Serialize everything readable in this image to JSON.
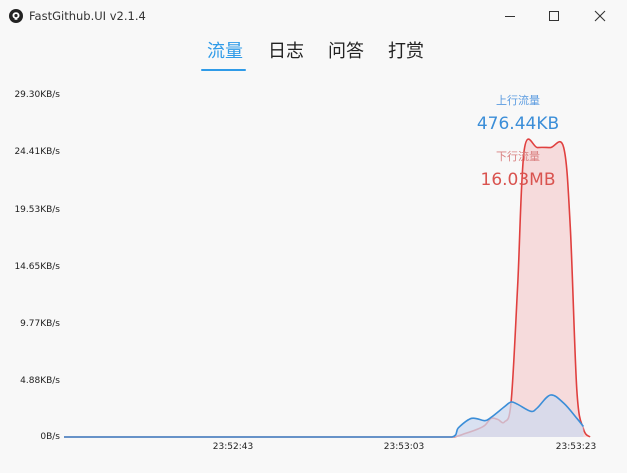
{
  "window": {
    "title": "FastGithub.UI v2.1.4"
  },
  "tabs": [
    {
      "label": "流量",
      "active": true
    },
    {
      "label": "日志",
      "active": false
    },
    {
      "label": "问答",
      "active": false
    },
    {
      "label": "打赏",
      "active": false
    }
  ],
  "icons": {
    "app": "github-icon",
    "minimize": "minimize-icon",
    "maximize": "maximize-icon",
    "close": "close-icon"
  },
  "colors": {
    "accent": "#2f9be8",
    "upload": "#3b8ed8",
    "download": "#e0403f",
    "download_fill": "#f6d2d3",
    "upload_fill": "#cfd9ef"
  },
  "chart_data": {
    "type": "area",
    "x_ticks": [
      "23:52:43",
      "23:53:03",
      "23:53:23"
    ],
    "x_range_seconds": [
      -17,
      23
    ],
    "y_ticks": [
      "29.30KB/s",
      "24.41KB/s",
      "19.53KB/s",
      "14.65KB/s",
      "9.77KB/s",
      "4.88KB/s",
      "0B/s"
    ],
    "y_range": [
      0,
      29.3
    ],
    "y_unit": "KB/s",
    "series": [
      {
        "name": "上行流量",
        "total": "476.44KB",
        "x": [
          -17,
          0,
          10,
          12.5,
          13,
          14,
          15,
          15.5,
          16.5,
          17,
          17.5,
          18.5,
          19,
          20,
          21,
          22,
          22.5
        ],
        "y": [
          0,
          0,
          0,
          0,
          0.8,
          1.6,
          1.4,
          1.7,
          2.6,
          3.0,
          2.8,
          2.2,
          2.5,
          3.6,
          2.9,
          1.6,
          0.9
        ]
      },
      {
        "name": "下行流量",
        "total": "16.03MB",
        "x": [
          -17,
          0,
          10,
          12.5,
          13.5,
          14.5,
          15,
          15.5,
          16,
          16.5,
          17,
          17.5,
          18,
          19,
          20,
          21,
          21.5,
          22,
          22.5,
          23
        ],
        "y": [
          0,
          0,
          0,
          0,
          0.3,
          0.7,
          1.0,
          1.6,
          1.5,
          1.3,
          3.0,
          13.0,
          24.6,
          24.8,
          24.8,
          24.8,
          18.0,
          4.0,
          0.7,
          0
        ]
      }
    ]
  }
}
